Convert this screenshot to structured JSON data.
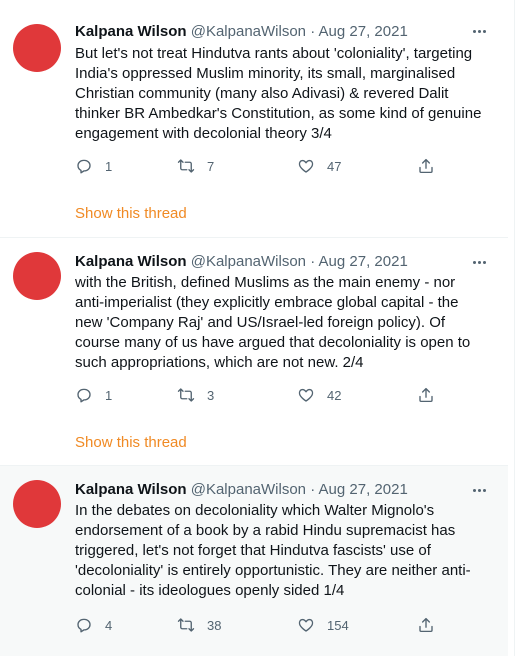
{
  "tweets": [
    {
      "name": "Kalpana Wilson",
      "handle": "@KalpanaWilson",
      "separator": "·",
      "date": "Aug 27, 2021",
      "text": "But let's not treat Hindutva rants about 'coloniality', targeting\nIndia's oppressed Muslim minority, its small, marginalised\nChristian community (many also Adivasi) & revered Dalit\nthinker BR Ambedkar's Constitution, as some kind of genuine\nengagement with decolonial theory 3/4",
      "replies": "1",
      "retweets": "7",
      "likes": "47",
      "show_thread": "Show this thread"
    },
    {
      "name": "Kalpana Wilson",
      "handle": "@KalpanaWilson",
      "separator": "·",
      "date": "Aug 27, 2021",
      "text": "with the British, defined Muslims as the main enemy - nor\nanti-imperialist (they explicitly embrace global capital - the\nnew 'Company Raj' and US/Israel-led foreign policy). Of\ncourse many of us have argued that decoloniality is open to\nsuch appropriations, which are not new. 2/4",
      "replies": "1",
      "retweets": "3",
      "likes": "42",
      "show_thread": "Show this thread"
    },
    {
      "name": "Kalpana Wilson",
      "handle": "@KalpanaWilson",
      "separator": "·",
      "date": "Aug 27, 2021",
      "text": "In the debates on decoloniality which Walter Mignolo's\nendorsement of a book by a rabid Hindu supremacist has\ntriggered, let's not forget that Hindutva fascists' use of\n'decoloniality' is entirely opportunistic. They are neither anti-\ncolonial - its ideologues openly sided 1/4",
      "replies": "4",
      "retweets": "38",
      "likes": "154"
    }
  ],
  "icons": {
    "reply": "reply-icon",
    "retweet": "retweet-icon",
    "like": "heart-icon",
    "share": "share-icon",
    "more": "more-icon"
  },
  "colors": {
    "avatar": "#e0383a",
    "accent_link": "#f08a24",
    "secondary_text": "#536471",
    "highlight_bg": "#f7f9f9"
  }
}
